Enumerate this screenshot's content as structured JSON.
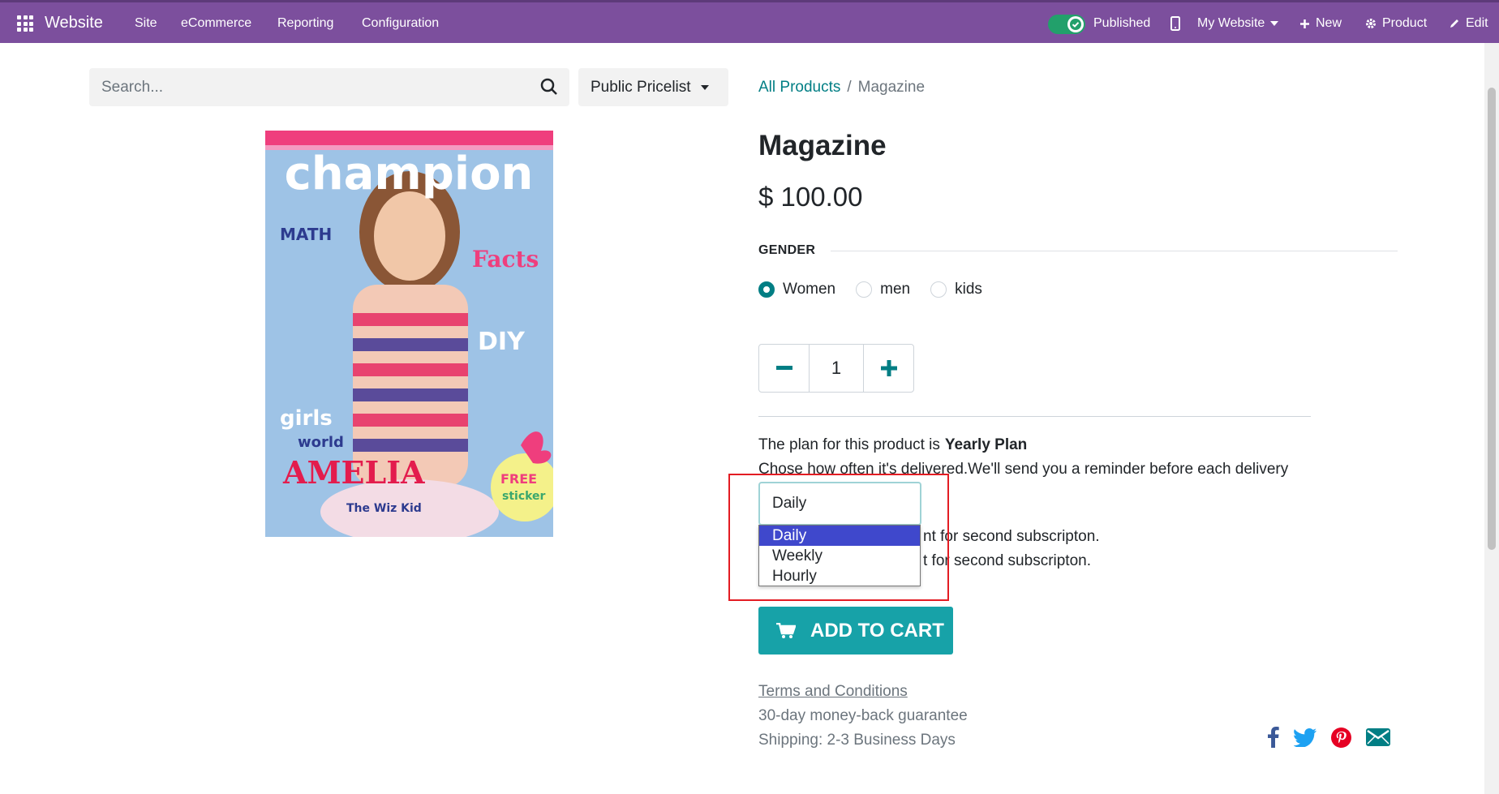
{
  "topbar": {
    "brand": "Website",
    "menus": [
      "Site",
      "eCommerce",
      "Reporting",
      "Configuration"
    ],
    "published_label": "Published",
    "website_label": "My Website",
    "new_label": "New",
    "product_label": "Product",
    "edit_label": "Edit"
  },
  "search": {
    "placeholder": "Search...",
    "pricelist": "Public Pricelist"
  },
  "breadcrumb": {
    "parent": "All Products",
    "separator": "/",
    "current": "Magazine"
  },
  "product": {
    "name": "Magazine",
    "price": "$ 100.00",
    "attribute_label": "GENDER",
    "attribute_options": [
      "Women",
      "men",
      "kids"
    ],
    "selected_option": "Women",
    "quantity": "1",
    "plan_prefix": "The plan for this product is",
    "plan_name": "Yearly Plan",
    "delivery_note": "Chose how often it's delivered.We'll send you a reminder before each delivery",
    "discount_line_1": "nt for second subscripton.",
    "discount_line_2": "t for second subscripton.",
    "frequency_select": {
      "selected": "Daily",
      "options": [
        "Daily",
        "Weekly",
        "Hourly"
      ],
      "highlighted": "Daily"
    },
    "add_to_cart": "ADD TO CART",
    "terms": "Terms and Conditions",
    "guarantee": "30-day money-back guarantee",
    "shipping": "Shipping: 2-3 Business Days"
  },
  "image_text": {
    "masthead": "champion",
    "math": "MATH",
    "facts": "Facts",
    "diy": "DIY",
    "girls": "girls",
    "world": "world",
    "amelia": "AMELIA",
    "free": "FREE",
    "sticker": "sticker",
    "wiz": "The Wiz Kid"
  },
  "colors": {
    "navbar": "#7c4f9d",
    "accent": "#017e84",
    "cart_button": "#17a2a8",
    "highlight_box": "#e31c23",
    "option_selected": "#3f48cc"
  },
  "icons": {
    "social": [
      "facebook-icon",
      "twitter-icon",
      "pinterest-icon",
      "email-icon"
    ]
  }
}
